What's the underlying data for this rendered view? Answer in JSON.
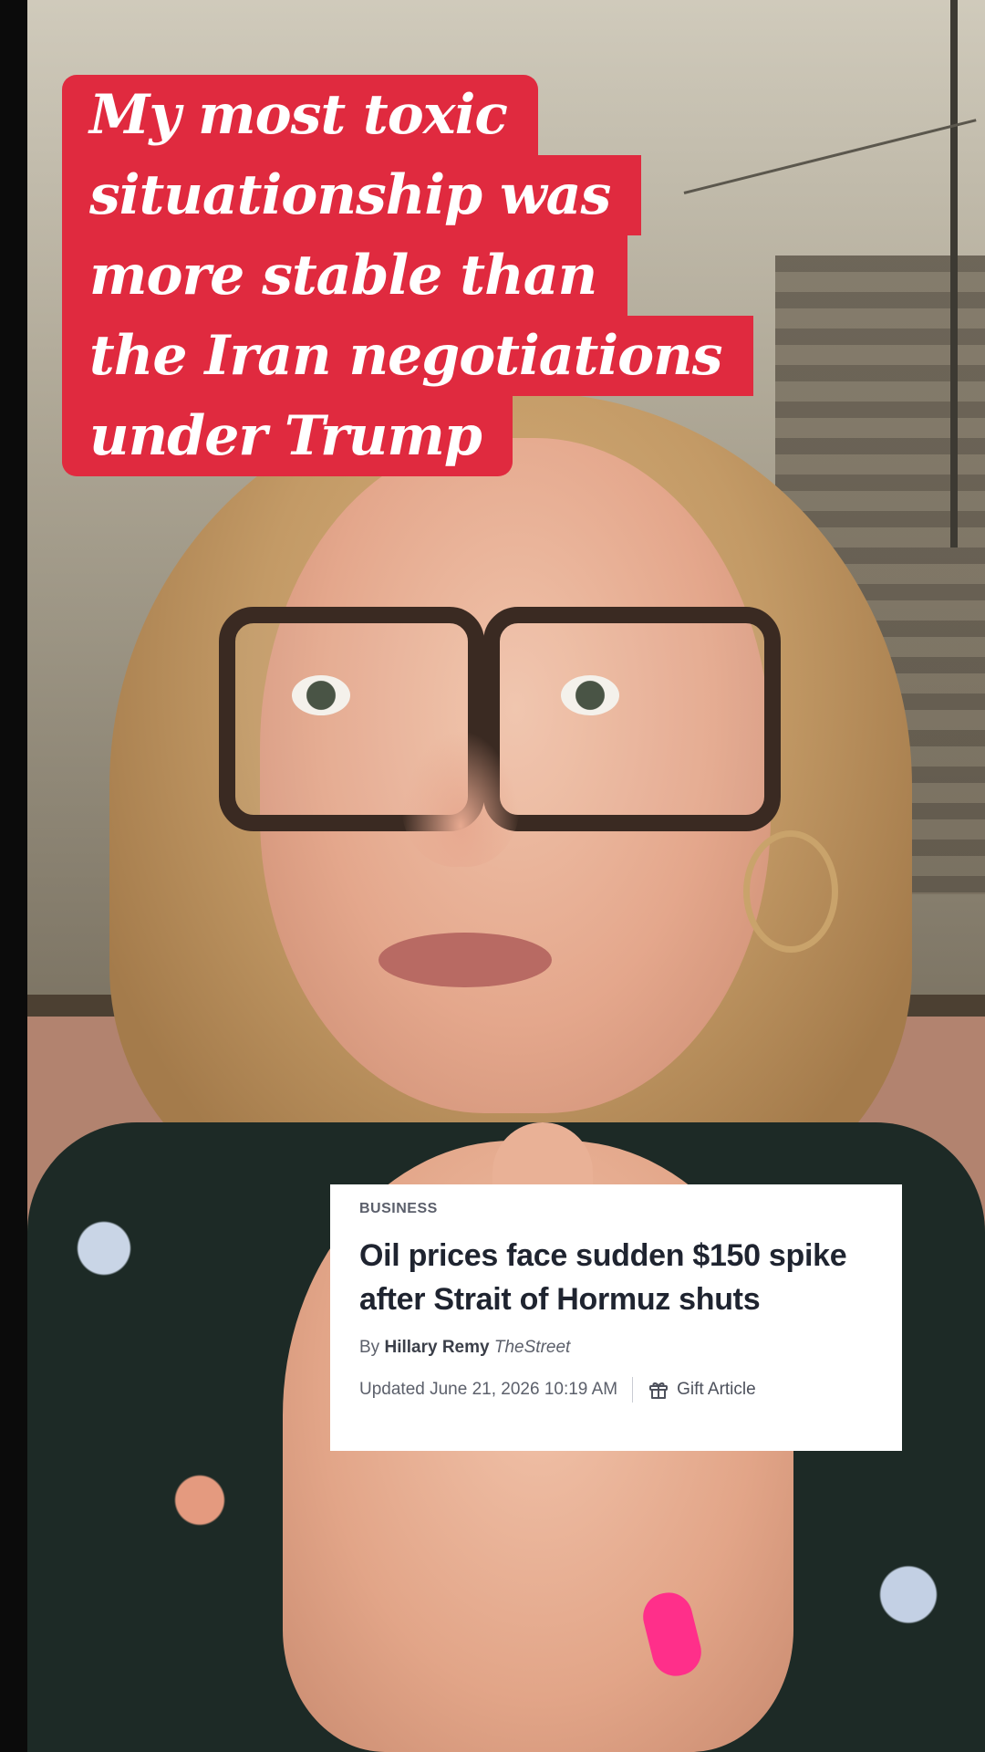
{
  "caption": {
    "lines": [
      "My most toxic",
      "situationship was",
      "more stable than",
      "the Iran negotiations",
      "under Trump"
    ],
    "background_color": "#e02a3f",
    "text_color": "#ffffff"
  },
  "article_card": {
    "section": "BUSINESS",
    "headline": "Oil prices face sudden $150 spike after Strait of Hormuz shuts",
    "byline_prefix": "By",
    "author": "Hillary Remy",
    "outlet": "TheStreet",
    "updated": "Updated June 21, 2026 10:19 AM",
    "gift_label": "Gift Article",
    "gift_icon": "gift-icon"
  }
}
